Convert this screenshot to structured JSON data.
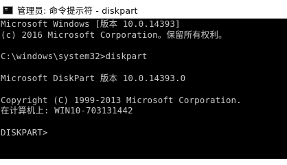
{
  "window": {
    "title": "管理员: 命令提示符 - diskpart",
    "icon": "cmd-console-icon"
  },
  "console": {
    "lines": [
      "Microsoft Windows [版本 10.0.14393]",
      "(c) 2016 Microsoft Corporation。保留所有权利。",
      "",
      "C:\\windows\\system32>diskpart",
      "",
      "Microsoft DiskPart 版本 10.0.14393.0",
      "",
      "Copyright (C) 1999-2013 Microsoft Corporation.",
      "在计算机上: WIN10-703131442",
      "",
      "DISKPART> "
    ]
  },
  "colors": {
    "console_background": "#000000",
    "console_text": "#c8c8c8",
    "titlebar_background": "#ffffff",
    "title_text": "#000000"
  }
}
